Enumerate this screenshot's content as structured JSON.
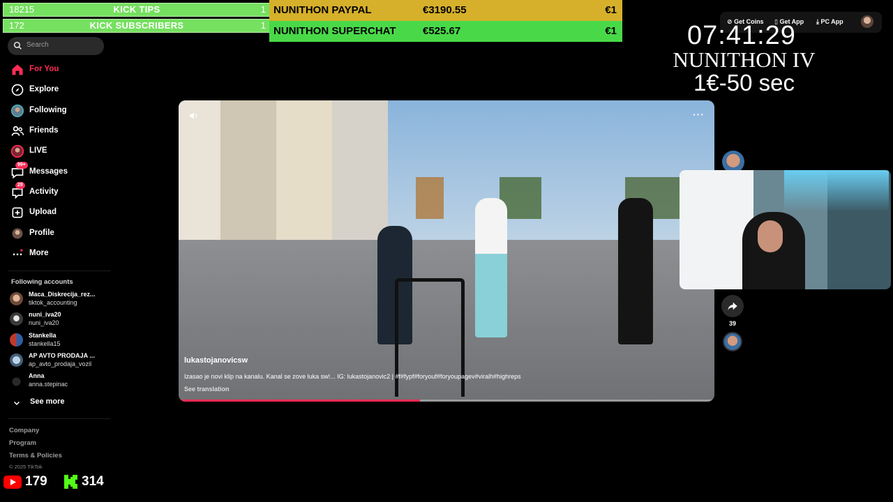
{
  "overlay": {
    "kick_tips": {
      "count": "18215",
      "label": "KICK TIPS",
      "num": "1"
    },
    "kick_subscribers": {
      "count": "172",
      "label": "KICK SUBSCRIBERS",
      "num": "1"
    },
    "nunithon_paypal": {
      "label": "NUNITHON PAYPAL",
      "amount": "€3190.55",
      "unit": "€1"
    },
    "nunithon_superchat": {
      "label": "NUNITHON SUPERCHAT",
      "amount": "€525.67",
      "unit": "€1"
    },
    "timer": "07:41:29",
    "nunithon_title": "NUNITHON IV",
    "nunithon_rate": "1€-50 sec",
    "youtube_count": "179",
    "kick_count": "314"
  },
  "colors": {
    "accent": "#fe2c55",
    "paypal_bar": "#d6b02a",
    "superchat_bar": "#49d948",
    "kick_bar": "#76e060"
  },
  "search": {
    "placeholder": "Search"
  },
  "nav": {
    "for_you": "For You",
    "explore": "Explore",
    "following": "Following",
    "friends": "Friends",
    "live": "LIVE",
    "messages": "Messages",
    "messages_badge": "99+",
    "activity": "Activity",
    "activity_badge": "29",
    "upload": "Upload",
    "profile": "Profile",
    "more": "More"
  },
  "following_accounts": {
    "title": "Following accounts",
    "items": [
      {
        "name": "Maca_Diskrecija_rez...",
        "user": "tiktok_accounting"
      },
      {
        "name": "nuni_iva20",
        "user": "nuni_iva20"
      },
      {
        "name": "Stankella",
        "user": "stankella15"
      },
      {
        "name": "AP AVTO PRODAJA ...",
        "user": "ap_avto_prodaja_vozil"
      },
      {
        "name": "Anna",
        "user": "anna.stepinac"
      }
    ],
    "see_more": "See more"
  },
  "footer": {
    "company": "Company",
    "program": "Program",
    "terms": "Terms & Policies",
    "copyright": "© 2025 TikTok"
  },
  "top_actions": {
    "get_coins": "Get Coins",
    "get_app": "Get App",
    "pc_app": "PC App"
  },
  "video": {
    "author": "lukastojanovicsw",
    "description": "Izasao je novi klip na kanalu. Kanal se zove luka sw!... IG: lukastojanovic2 | #f#fypf#foryouf#foryoupagev#viralh#highreps",
    "see_translation": "See translation",
    "progress": 0.45,
    "share_count": "39"
  }
}
